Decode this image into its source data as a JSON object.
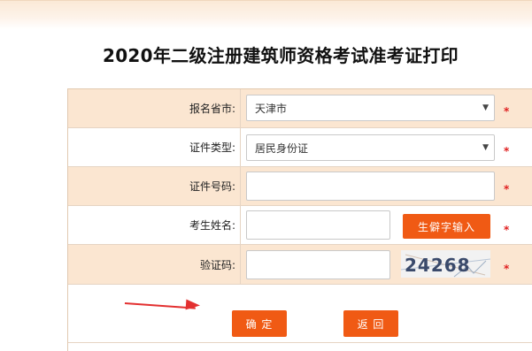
{
  "page": {
    "title": "2020年二级注册建筑师资格考试准考证打印"
  },
  "form": {
    "province": {
      "label": "报名省市:",
      "value": "天津市"
    },
    "id_type": {
      "label": "证件类型:",
      "value": "居民身份证"
    },
    "id_number": {
      "label": "证件号码:",
      "value": ""
    },
    "name": {
      "label": "考生姓名:",
      "value": "",
      "rare_char_button": "生僻字输入"
    },
    "captcha": {
      "label": "验证码:",
      "value": "",
      "image_text": "24268"
    },
    "required_mark": "*"
  },
  "actions": {
    "confirm_label": "确 定",
    "back_label": "返 回"
  },
  "colors": {
    "accent": "#f05a14",
    "row_shade": "#fbe6d1",
    "required": "#e02020",
    "annotation_arrow": "#e33030"
  },
  "icons": {
    "dropdown": "chevron-down-icon",
    "annotation": "red-arrow-icon"
  }
}
